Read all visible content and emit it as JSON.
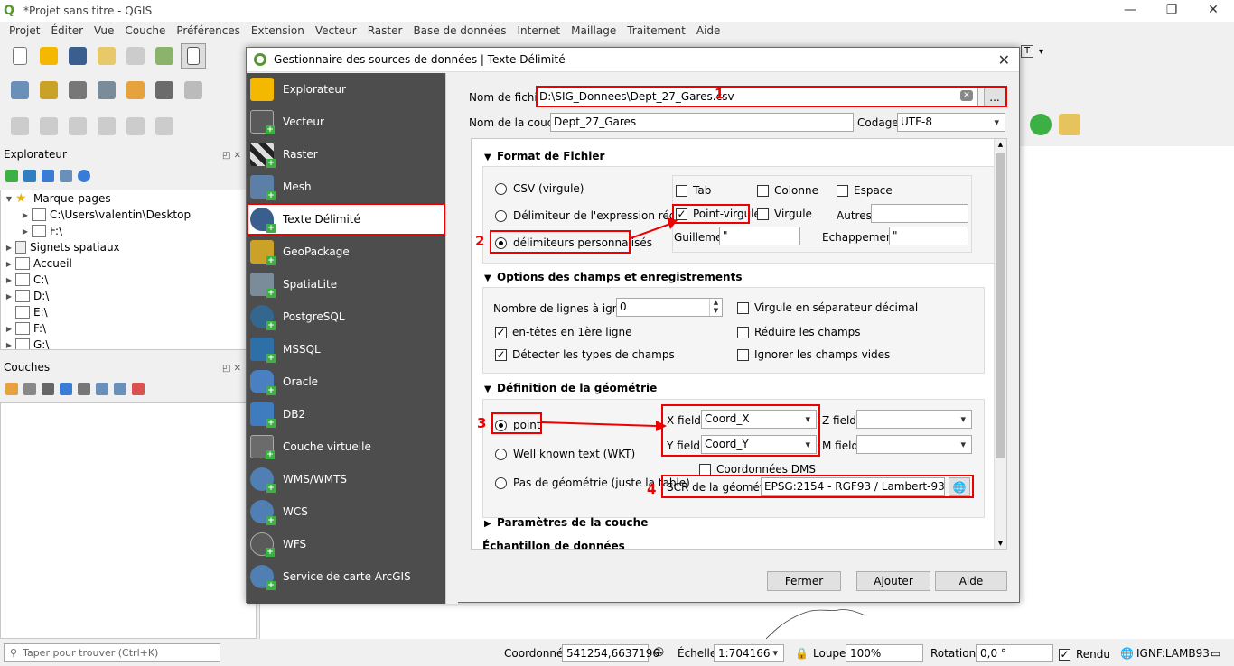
{
  "app": {
    "title": "*Projet sans titre - QGIS",
    "logo": "Q"
  },
  "menu": [
    "Projet",
    "Éditer",
    "Vue",
    "Couche",
    "Préférences",
    "Extension",
    "Vecteur",
    "Raster",
    "Base de données",
    "Internet",
    "Maillage",
    "Traitement",
    "Aide"
  ],
  "panels": {
    "browser_title": "Explorateur",
    "layers_title": "Couches",
    "tree": [
      {
        "label": "Marque-pages",
        "indent": 0,
        "arrow": "▼",
        "icon": "star"
      },
      {
        "label": "C:\\Users\\valentin\\Desktop",
        "indent": 1,
        "arrow": "▶",
        "icon": "folder"
      },
      {
        "label": "F:\\",
        "indent": 1,
        "arrow": "▶",
        "icon": "folder"
      },
      {
        "label": "Signets spatiaux",
        "indent": 0,
        "arrow": "▶",
        "icon": "bookmark"
      },
      {
        "label": "Accueil",
        "indent": 0,
        "arrow": "▶",
        "icon": "folder"
      },
      {
        "label": "C:\\",
        "indent": 0,
        "arrow": "▶",
        "icon": "folder"
      },
      {
        "label": "D:\\",
        "indent": 0,
        "arrow": "▶",
        "icon": "folder"
      },
      {
        "label": "E:\\",
        "indent": 0,
        "arrow": "",
        "icon": "folder"
      },
      {
        "label": "F:\\",
        "indent": 0,
        "arrow": "▶",
        "icon": "folder"
      },
      {
        "label": "G:\\",
        "indent": 0,
        "arrow": "▶",
        "icon": "folder"
      }
    ]
  },
  "dialog": {
    "title": "Gestionnaire des sources de données | Texte Délimité",
    "sources": [
      {
        "label": "Explorateur",
        "color": "#f5b800"
      },
      {
        "label": "Vecteur",
        "color": "#666666"
      },
      {
        "label": "Raster",
        "color": "#555555"
      },
      {
        "label": "Mesh",
        "color": "#5b7fa6"
      },
      {
        "label": "Texte Délimité",
        "color": "#3a5f8f"
      },
      {
        "label": "GeoPackage",
        "color": "#c9a227"
      },
      {
        "label": "SpatiaLite",
        "color": "#7a8c99"
      },
      {
        "label": "PostgreSQL",
        "color": "#33678f"
      },
      {
        "label": "MSSQL",
        "color": "#2f6fa8"
      },
      {
        "label": "Oracle",
        "color": "#4a7fc1"
      },
      {
        "label": "DB2",
        "color": "#3e7bbf"
      },
      {
        "label": "Couche virtuelle",
        "color": "#6b6b6b"
      },
      {
        "label": "WMS/WMTS",
        "color": "#4f7fb3"
      },
      {
        "label": "WCS",
        "color": "#4f7fb3"
      },
      {
        "label": "WFS",
        "color": "#5a5a5a"
      },
      {
        "label": "Service de carte ArcGIS",
        "color": "#4f7fb3"
      }
    ],
    "file_label": "Nom de fichier",
    "file_value": "D:\\SIG_Donnees\\Dept_27_Gares.csv",
    "browse_label": "...",
    "layer_label": "Nom de la couche",
    "layer_value": "Dept_27_Gares",
    "encoding_label": "Codage",
    "encoding_value": "UTF-8",
    "format": {
      "title": "Format de Fichier",
      "csv": "CSV (virgule)",
      "regex": "Délimiteur de l'expression régulière",
      "custom": "délimiteurs personnalisés",
      "tab": "Tab",
      "colonne": "Colonne",
      "espace": "Espace",
      "point_virgule": "Point-virgule",
      "virgule": "Virgule",
      "autres": "Autres",
      "guillemet": "Guillemet",
      "guillemet_value": "\"",
      "echappement": "Echappement",
      "echappement_value": "\""
    },
    "options": {
      "title": "Options des champs et enregistrements",
      "skip_lines": "Nombre de lignes à ignorer",
      "skip_value": "0",
      "headers": "en-têtes en 1ère ligne",
      "detect_types": "Détecter les types de champs",
      "decimal_comma": "Virgule en séparateur décimal",
      "trim": "Réduire les champs",
      "ignore_empty": "Ignorer les champs vides"
    },
    "geometry": {
      "title": "Définition de la géométrie",
      "point": "point",
      "wkt": "Well known text (WKT)",
      "none": "Pas de géométrie (juste la table)",
      "x_label": "X field",
      "x_value": "Coord_X",
      "y_label": "Y field",
      "y_value": "Coord_Y",
      "z_label": "Z field",
      "m_label": "M field",
      "dms": "Coordonnées DMS",
      "crs_label": "SCR de la géométrie",
      "crs_value": "EPSG:2154 - RGF93 / Lambert-93"
    },
    "layer_params": "Paramètres de la couche",
    "sample": "Échantillon de données",
    "buttons": {
      "close": "Fermer",
      "add": "Ajouter",
      "help": "Aide"
    }
  },
  "annotations": [
    "1",
    "2",
    "3",
    "4"
  ],
  "status": {
    "search_placeholder": "Taper pour trouver (Ctrl+K)",
    "coord_label": "Coordonnée",
    "coord_value": "541254,6637196",
    "scale_label": "Échelle",
    "scale_value": "1:704166",
    "zoom_label": "Loupe",
    "zoom_value": "100%",
    "rotation_label": "Rotation",
    "rotation_value": "0,0 °",
    "render_label": "Rendu",
    "crs": "IGNF:LAMB93"
  },
  "colors": {
    "annotation": "#ee0000",
    "sidebar": "#4d4d4d",
    "accent": "#589632"
  }
}
